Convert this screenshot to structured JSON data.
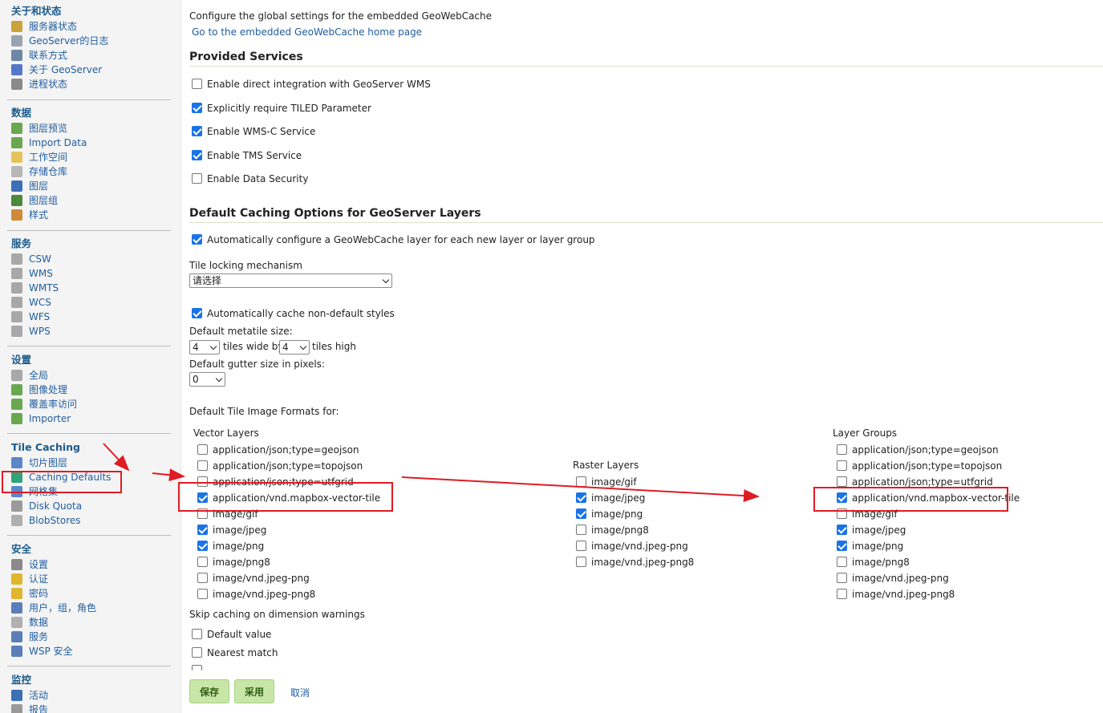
{
  "sidebar": {
    "sections": [
      {
        "title": "关于和状态",
        "items": [
          {
            "label": "服务器状态",
            "icon": "server-status-icon",
            "color": "#c9a43a"
          },
          {
            "label": "GeoServer的日志",
            "icon": "log-document-icon",
            "color": "#9aa4b1"
          },
          {
            "label": "联系方式",
            "icon": "contact-card-icon",
            "color": "#6f87a7"
          },
          {
            "label": "关于 GeoServer",
            "icon": "info-help-icon",
            "color": "#5577c8"
          },
          {
            "label": "进程状态",
            "icon": "gear-icon",
            "color": "#8a8a8a"
          }
        ]
      },
      {
        "title": "数据",
        "items": [
          {
            "label": "图层预览",
            "icon": "layer-preview-icon",
            "color": "#6aa84f"
          },
          {
            "label": "Import Data",
            "icon": "import-data-icon",
            "color": "#6aa84f"
          },
          {
            "label": "工作空间",
            "icon": "folder-icon",
            "color": "#e6c25a"
          },
          {
            "label": "存储仓库",
            "icon": "database-icon",
            "color": "#b7b7b7"
          },
          {
            "label": "图层",
            "icon": "layer-icon",
            "color": "#3d6fb6"
          },
          {
            "label": "图层组",
            "icon": "layer-group-icon",
            "color": "#4a8a3a"
          },
          {
            "label": "样式",
            "icon": "palette-icon",
            "color": "#d08a3a"
          }
        ]
      },
      {
        "title": "服务",
        "items": [
          {
            "label": "CSW",
            "icon": "service-icon",
            "color": "#a8a8a8"
          },
          {
            "label": "WMS",
            "icon": "service-icon",
            "color": "#a8a8a8"
          },
          {
            "label": "WMTS",
            "icon": "service-icon",
            "color": "#a8a8a8"
          },
          {
            "label": "WCS",
            "icon": "service-icon",
            "color": "#a8a8a8"
          },
          {
            "label": "WFS",
            "icon": "service-icon",
            "color": "#a8a8a8"
          },
          {
            "label": "WPS",
            "icon": "service-icon",
            "color": "#a8a8a8"
          }
        ]
      },
      {
        "title": "设置",
        "items": [
          {
            "label": "全局",
            "icon": "global-settings-icon",
            "color": "#a8a8a8"
          },
          {
            "label": "图像处理",
            "icon": "image-processing-icon",
            "color": "#6aa84f"
          },
          {
            "label": "覆盖率访问",
            "icon": "coverage-access-icon",
            "color": "#6aa84f"
          },
          {
            "label": "Importer",
            "icon": "importer-icon",
            "color": "#6aa84f"
          }
        ]
      },
      {
        "title": "Tile Caching",
        "items": [
          {
            "label": "切片图层",
            "icon": "tile-layers-icon",
            "color": "#5b87c9"
          },
          {
            "label": "Caching Defaults",
            "icon": "caching-defaults-icon",
            "color": "#2fa37a"
          },
          {
            "label": "网格集",
            "icon": "gridset-icon",
            "color": "#5b87c9"
          },
          {
            "label": "Disk Quota",
            "icon": "disk-quota-icon",
            "color": "#9a9a9a"
          },
          {
            "label": "BlobStores",
            "icon": "blobstore-icon",
            "color": "#b0b0b0"
          }
        ]
      },
      {
        "title": "安全",
        "items": [
          {
            "label": "设置",
            "icon": "wrench-icon",
            "color": "#8a8a8a"
          },
          {
            "label": "认证",
            "icon": "shield-icon",
            "color": "#e0b62e"
          },
          {
            "label": "密码",
            "icon": "lock-icon",
            "color": "#e0b62e"
          },
          {
            "label": "用户，组，角色",
            "icon": "users-icon",
            "color": "#5a7fb8"
          },
          {
            "label": "数据",
            "icon": "data-security-icon",
            "color": "#b0b0b0"
          },
          {
            "label": "服务",
            "icon": "service-security-icon",
            "color": "#5a7fb8"
          },
          {
            "label": "WSP 安全",
            "icon": "wps-security-icon",
            "color": "#5a7fb8"
          }
        ]
      },
      {
        "title": "监控",
        "items": [
          {
            "label": "活动",
            "icon": "activity-chart-icon",
            "color": "#3d6fb6"
          },
          {
            "label": "报告",
            "icon": "report-icon",
            "color": "#9a9a9a"
          }
        ]
      }
    ]
  },
  "header": {
    "description": "Configure the global settings for the embedded GeoWebCache",
    "home_link": "Go to the embedded GeoWebCache home page"
  },
  "provided_services": {
    "title": "Provided Services",
    "options": [
      {
        "label": "Enable direct integration with GeoServer WMS",
        "checked": false
      },
      {
        "label": "Explicitly require TILED Parameter",
        "checked": true
      },
      {
        "label": "Enable WMS-C Service",
        "checked": true
      },
      {
        "label": "Enable TMS Service",
        "checked": true
      },
      {
        "label": "Enable Data Security",
        "checked": false
      }
    ]
  },
  "defaults": {
    "title": "Default Caching Options for GeoServer Layers",
    "auto_configure": {
      "label": "Automatically configure a GeoWebCache layer for each new layer or layer group",
      "checked": true
    },
    "tile_locking_label": "Tile locking mechanism",
    "tile_locking_value": "请选择",
    "auto_cache_styles": {
      "label": "Automatically cache non-default styles",
      "checked": true
    },
    "metatile_label": "Default metatile size:",
    "metatile_wide": "4",
    "tiles_wide_by": "tiles wide by",
    "metatile_high": "4",
    "tiles_high": "tiles high",
    "gutter_label": "Default gutter size in pixels:",
    "gutter_value": "0",
    "formats_label": "Default Tile Image Formats for:"
  },
  "formats": {
    "vector": {
      "title": "Vector Layers",
      "items": [
        {
          "label": "application/json;type=geojson",
          "checked": false
        },
        {
          "label": "application/json;type=topojson",
          "checked": false
        },
        {
          "label": "application/json;type=utfgrid",
          "checked": false
        },
        {
          "label": "application/vnd.mapbox-vector-tile",
          "checked": true
        },
        {
          "label": "image/gif",
          "checked": false
        },
        {
          "label": "image/jpeg",
          "checked": true
        },
        {
          "label": "image/png",
          "checked": true
        },
        {
          "label": "image/png8",
          "checked": false
        },
        {
          "label": "image/vnd.jpeg-png",
          "checked": false
        },
        {
          "label": "image/vnd.jpeg-png8",
          "checked": false
        }
      ]
    },
    "raster": {
      "title": "Raster Layers",
      "items": [
        {
          "label": "image/gif",
          "checked": false
        },
        {
          "label": "image/jpeg",
          "checked": true
        },
        {
          "label": "image/png",
          "checked": true
        },
        {
          "label": "image/png8",
          "checked": false
        },
        {
          "label": "image/vnd.jpeg-png",
          "checked": false
        },
        {
          "label": "image/vnd.jpeg-png8",
          "checked": false
        }
      ]
    },
    "groups": {
      "title": "Layer Groups",
      "items": [
        {
          "label": "application/json;type=geojson",
          "checked": false
        },
        {
          "label": "application/json;type=topojson",
          "checked": false
        },
        {
          "label": "application/json;type=utfgrid",
          "checked": false
        },
        {
          "label": "application/vnd.mapbox-vector-tile",
          "checked": true
        },
        {
          "label": "image/gif",
          "checked": false
        },
        {
          "label": "image/jpeg",
          "checked": true
        },
        {
          "label": "image/png",
          "checked": true
        },
        {
          "label": "image/png8",
          "checked": false
        },
        {
          "label": "image/vnd.jpeg-png",
          "checked": false
        },
        {
          "label": "image/vnd.jpeg-png8",
          "checked": false
        }
      ]
    }
  },
  "dimension_warnings": {
    "title": "Skip caching on dimension warnings",
    "options": [
      {
        "label": "Default value",
        "checked": false
      },
      {
        "label": "Nearest match",
        "checked": false
      }
    ]
  },
  "buttons": {
    "save": "保存",
    "apply": "采用",
    "cancel": "取消"
  },
  "annotation_color": "#e01b24"
}
